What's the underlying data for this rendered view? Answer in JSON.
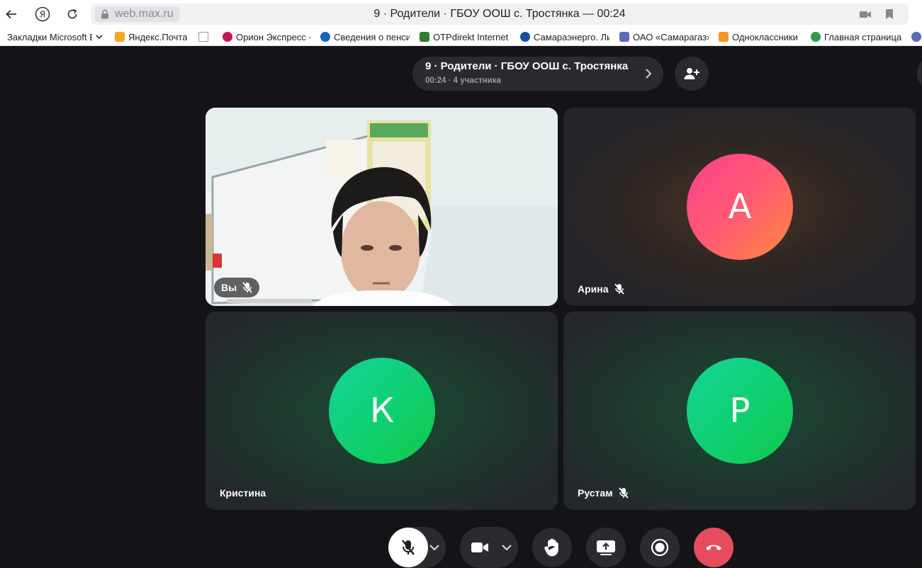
{
  "browser": {
    "url": "web.max.ru",
    "page_title": "9 · Родители · ГБОУ ООШ с. Тростянка — 00:24",
    "bookmarks": [
      {
        "label": "Закладки Microsoft Edge",
        "icon": "folder-icon",
        "color": "#ffffff"
      },
      {
        "label": "Яндекс.Почта",
        "icon": "mail-icon",
        "color": "#f5a623"
      },
      {
        "label": "",
        "icon": "page-icon",
        "color": "#ffffff"
      },
      {
        "label": "Орион Экспресс - ",
        "icon": "orion-icon",
        "color": "#c2185b"
      },
      {
        "label": "Сведения о пенсии",
        "icon": "pension-fund-icon",
        "color": "#1565c0"
      },
      {
        "label": "OTPdirekt Internet",
        "icon": "otp-icon",
        "color": "#2e7d32"
      },
      {
        "label": "Самараэнерго. Личный",
        "icon": "samaraenergo-icon",
        "color": "#1a4fa0"
      },
      {
        "label": "ОАО «Самарагаз»",
        "icon": "samaragaz-icon",
        "color": "#5c6bc0"
      },
      {
        "label": "Одноклассники",
        "icon": "ok-icon",
        "color": "#f7931e"
      },
      {
        "label": "Главная страница",
        "icon": "globe-green-icon",
        "color": "#2e9d45"
      }
    ]
  },
  "call": {
    "title": "9 · Родители · ГБОУ ООШ с. Тростянка",
    "subtitle": "00:24 · 4 участника",
    "participants": [
      {
        "name": "Вы",
        "initial": "",
        "muted": true
      },
      {
        "name": "Арина",
        "initial": "А",
        "muted": true
      },
      {
        "name": "Кристина",
        "initial": "К",
        "muted": false
      },
      {
        "name": "Рустам",
        "initial": "Р",
        "muted": true
      }
    ]
  },
  "controls": [
    "mic-muted-icon",
    "camera-icon",
    "raise-hand-icon",
    "screen-share-icon",
    "record-icon",
    "end-call-icon"
  ],
  "colors": {
    "end_call": "#e74c5e",
    "accent_green": "#10cf6a",
    "accent_pink": "#ff4b86"
  }
}
